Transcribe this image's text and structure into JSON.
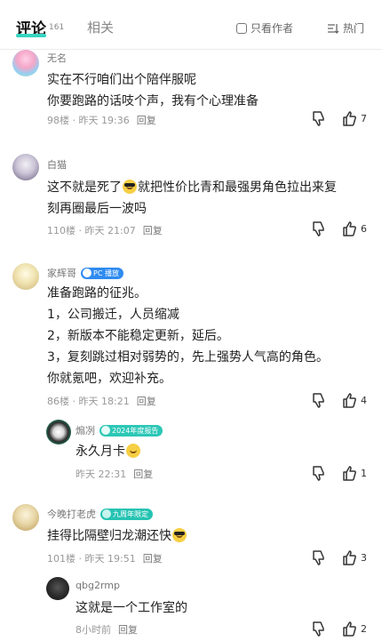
{
  "header": {
    "tab_comments": "评论",
    "comment_count": "161",
    "tab_related": "相关",
    "only_author": "只看作者",
    "sort_label": "热门"
  },
  "comments": [
    {
      "username": "无名",
      "lines": [
        "实在不行咱们出个陪伴服呢",
        "你要跑路的话吱个声，我有个心理准备"
      ],
      "floor": "98楼",
      "time": "昨天 19:36",
      "reply": "回复",
      "likes": "7"
    },
    {
      "username": "白猫",
      "line1_before": "这不就是死了",
      "line1_after": "就把性价比青和最强男角色拉出来复",
      "line2": "刻再圈最后一波吗",
      "floor": "110楼",
      "time": "昨天 21:07",
      "reply": "回复",
      "likes": "6"
    },
    {
      "username": "家辉哥",
      "badge": "PC 播放",
      "lines": [
        "准备跑路的征兆。",
        "1，公司搬迁，人员缩减",
        "2，新版本不能稳定更新，延后。",
        "3，复刻跳过相对弱势的，先上强势人气高的角色。",
        "你就氪吧，欢迎补充。"
      ],
      "floor": "86楼",
      "time": "昨天 18:21",
      "reply": "回复",
      "likes": "4",
      "sub": {
        "username": "煽冽",
        "badge": "2024年度报告",
        "text": "永久月卡",
        "time": "昨天 22:31",
        "reply": "回复",
        "likes": "1"
      }
    },
    {
      "username": "今晚打老虎",
      "badge": "九周年限定",
      "text": "挂得比隔壁归龙潮还快",
      "floor": "101楼",
      "time": "昨天 19:51",
      "reply": "回复",
      "likes": "3",
      "sub": {
        "username": "qbg2rmp",
        "text": "这就是一个工作室的",
        "time": "8小时前",
        "reply": "回复",
        "likes": "2"
      }
    }
  ],
  "colors": {
    "accent": "#35d4c0",
    "meta": "#999999",
    "badge_blue": "#2f8bf0",
    "badge_teal": "#2cc7b6"
  },
  "icons": [
    "checkbox-icon",
    "sort-icon",
    "dislike-icon",
    "like-icon",
    "smile-emoji-icon",
    "sunglasses-emoji-icon"
  ]
}
